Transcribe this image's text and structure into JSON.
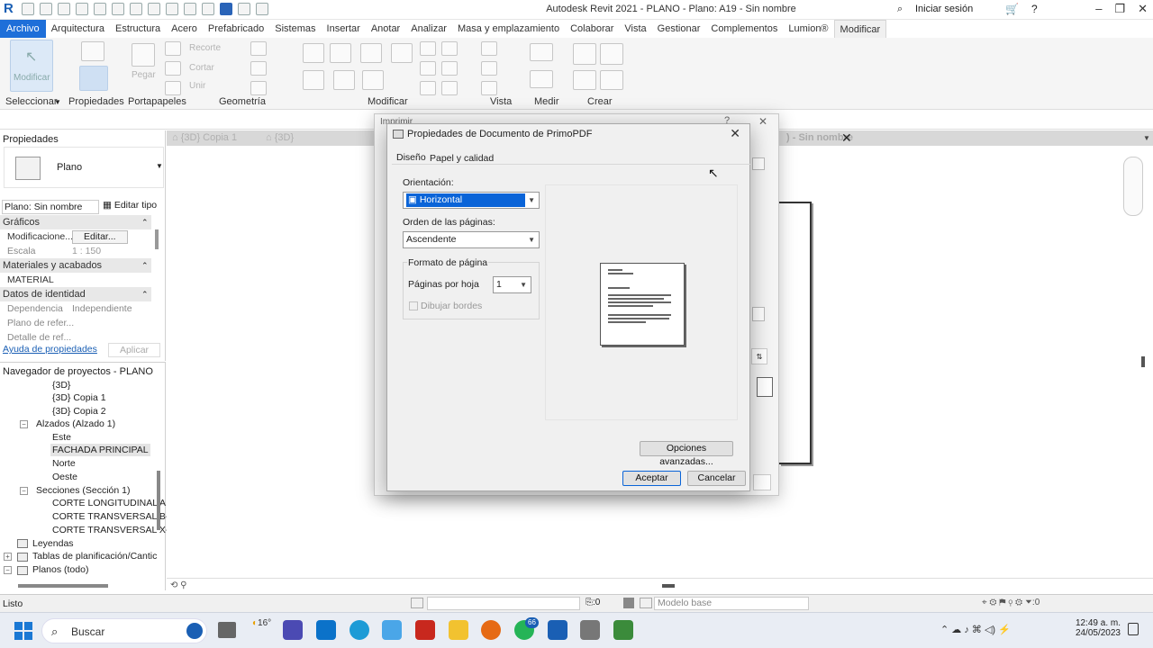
{
  "window": {
    "title": "Autodesk Revit 2021 - PLANO - Plano: A19 - Sin nombre",
    "signin": "Iniciar sesión"
  },
  "ribbon_tabs": [
    "Archivo",
    "Arquitectura",
    "Estructura",
    "Acero",
    "Prefabricado",
    "Sistemas",
    "Insertar",
    "Anotar",
    "Analizar",
    "Masa y emplazamiento",
    "Colaborar",
    "Vista",
    "Gestionar",
    "Complementos",
    "Lumion®",
    "Modificar"
  ],
  "ribbon": {
    "modify_button": "Modificar",
    "paste": "Pegar",
    "cut_label": "Recorte",
    "cortar": "Cortar",
    "unir": "Unir",
    "groups": [
      "Seleccionar",
      "Propiedades",
      "Portapapeles",
      "Geometría",
      "Modificar",
      "Vista",
      "Medir",
      "Crear"
    ]
  },
  "properties": {
    "header": "Propiedades",
    "type_name": "Plano",
    "instance": "Plano: Sin nombre",
    "edit_type": "Editar tipo",
    "rows": [
      {
        "k": "Gráficos",
        "cat": true
      },
      {
        "k": "Modificacione...",
        "v": "Editar..."
      },
      {
        "k": "Escala",
        "v": "1 : 150"
      },
      {
        "k": "Materiales y acabados",
        "cat": true
      },
      {
        "k": "MATERIAL",
        "v": ""
      },
      {
        "k": "Datos de identidad",
        "cat": true
      },
      {
        "k": "Dependencia",
        "v": "Independiente"
      },
      {
        "k": "Plano de refer...",
        "v": ""
      },
      {
        "k": "Detalle de ref...",
        "v": ""
      }
    ],
    "help": "Ayuda de propiedades",
    "apply": "Aplicar"
  },
  "browser": {
    "header": "Navegador de proyectos - PLANO",
    "items": [
      "{3D}",
      "{3D} Copia 1",
      "{3D} Copia 2",
      "Alzados (Alzado 1)",
      "Este",
      "FACHADA PRINCIPAL",
      "Norte",
      "Oeste",
      "Secciones (Sección 1)",
      "CORTE LONGITUDINAL A",
      "CORTE TRANSVERSAL B-I",
      "CORTE TRANSVERSAL X-",
      "Leyendas",
      "Tablas de planificación/Cantic",
      "Planos (todo)"
    ]
  },
  "view_tabs": [
    "{3D} Copia 1",
    "{3D}",
    "Sin nombre"
  ],
  "print_dialog": {
    "title": "Imprimir",
    "help": "?"
  },
  "pdf_dialog": {
    "title": "Propiedades de Documento de PrimoPDF",
    "tabs": [
      "Diseño",
      "Papel y calidad"
    ],
    "orientation_label": "Orientación:",
    "orientation_value": "Horizontal",
    "page_order_label": "Orden de las páginas:",
    "page_order_value": "Ascendente",
    "page_format_label": "Formato de página",
    "pages_per_sheet_label": "Páginas por hoja",
    "pages_per_sheet_value": "1",
    "draw_borders": "Dibujar bordes",
    "advanced": "Opciones avanzadas...",
    "ok": "Aceptar",
    "cancel": "Cancelar"
  },
  "status": {
    "text": "Listo",
    "count": ":0",
    "model": "Modelo base",
    "filter": ":0"
  },
  "taskbar": {
    "search": "Buscar",
    "temp": "16°",
    "badge": "66",
    "time": "12:49 a. m.",
    "date": "24/05/2023"
  }
}
